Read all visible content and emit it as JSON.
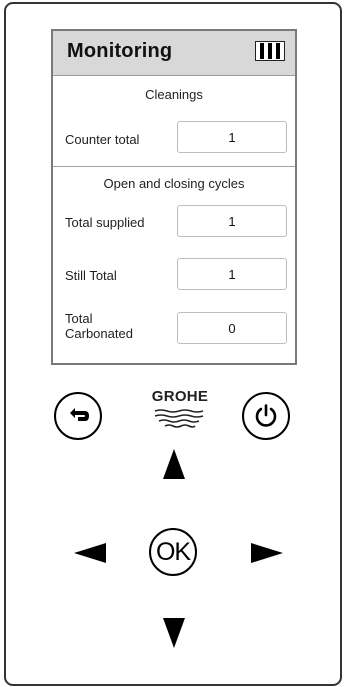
{
  "screen": {
    "title": "Monitoring",
    "battery_icon": "battery-icon",
    "sections": [
      {
        "title": "Cleanings",
        "rows": [
          {
            "label": "Counter total",
            "value": "1"
          }
        ]
      },
      {
        "title": "Open and closing cycles",
        "rows": [
          {
            "label": "Total supplied",
            "value": "1"
          },
          {
            "label": "Still Total",
            "value": "1"
          },
          {
            "label": "Total Carbonated",
            "value": "0"
          }
        ]
      }
    ]
  },
  "controls": {
    "back_icon": "back-arrow-icon",
    "power_icon": "power-icon",
    "ok_label": "OK",
    "up_icon": "up-arrow-icon",
    "down_icon": "down-arrow-icon",
    "left_icon": "left-arrow-icon",
    "right_icon": "right-arrow-icon"
  },
  "brand": {
    "logo_text": "GROHE"
  }
}
